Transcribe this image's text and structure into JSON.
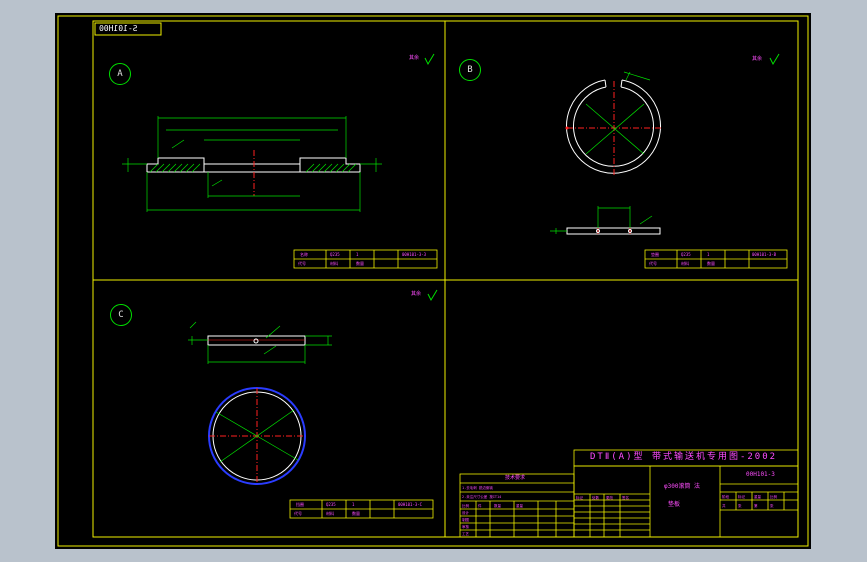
{
  "drawing": {
    "code_box": "S-101H00",
    "title_line": "DTⅡ(A)型  带式输送机专用图-2002",
    "drawing_no": "00H101-3",
    "part_name": "φ300滚筒 法",
    "part_sub": "垫板",
    "tech_req_header": "技术要求"
  },
  "views": [
    {
      "label": "A",
      "roughness": "其余"
    },
    {
      "label": "B",
      "roughness": "其余"
    },
    {
      "label": "C",
      "roughness": "其余"
    }
  ],
  "colors": {
    "background": "#000000",
    "frame": "#f0f000",
    "outline": "#ffffff",
    "green": "#00e000",
    "red": "#ff2020",
    "magenta": "#ff4dff",
    "blue": "#2a3cff"
  }
}
